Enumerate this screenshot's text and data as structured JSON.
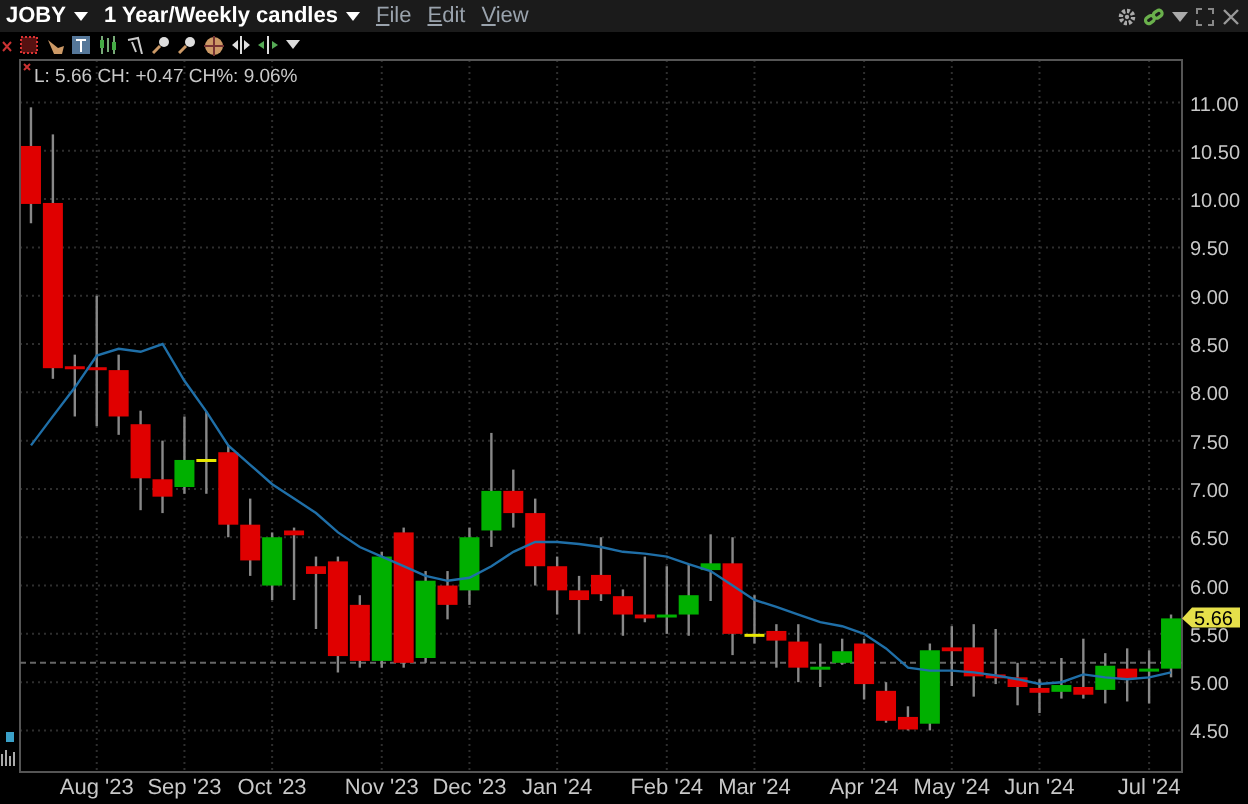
{
  "window": {
    "symbol": "JOBY",
    "period": "1 Year/Weekly candles",
    "menu": [
      "File",
      "Edit",
      "View"
    ]
  },
  "chart": {
    "info_line": "L: 5.66 CH: +0.47 CH%: 9.06%",
    "last_price": "5.66",
    "chart_data": {
      "type": "candlestick",
      "ylim": [
        4.07,
        11.44
      ],
      "categories": [
        null,
        null,
        null,
        "Aug '23",
        null,
        null,
        null,
        "Sep '23",
        null,
        null,
        null,
        "Oct '23",
        null,
        null,
        null,
        null,
        "Nov '23",
        null,
        null,
        null,
        "Dec '23",
        null,
        null,
        null,
        "Jan '24",
        null,
        null,
        null,
        null,
        "Feb '24",
        null,
        null,
        null,
        "Mar '24",
        null,
        null,
        null,
        null,
        "Apr '24",
        null,
        null,
        null,
        "May '24",
        null,
        null,
        null,
        "Jun '24",
        null,
        null,
        null,
        null,
        "Jul '24",
        null
      ],
      "ohlc": [
        [
          10.55,
          10.95,
          9.75,
          9.95
        ],
        [
          9.96,
          10.67,
          8.14,
          8.25
        ],
        [
          8.27,
          8.39,
          7.75,
          8.24
        ],
        [
          8.26,
          9.0,
          7.65,
          8.23
        ],
        [
          8.23,
          8.39,
          7.56,
          7.75
        ],
        [
          7.67,
          7.81,
          6.78,
          7.11
        ],
        [
          7.1,
          7.5,
          6.75,
          6.92
        ],
        [
          7.02,
          7.75,
          6.95,
          7.3
        ],
        [
          7.31,
          7.8,
          6.95,
          7.31
        ],
        [
          7.38,
          7.45,
          6.5,
          6.63
        ],
        [
          6.63,
          6.9,
          6.1,
          6.26
        ],
        [
          6.0,
          6.55,
          5.85,
          6.5
        ],
        [
          6.57,
          6.6,
          5.85,
          6.52
        ],
        [
          6.2,
          6.3,
          5.55,
          6.12
        ],
        [
          6.25,
          6.3,
          5.1,
          5.27
        ],
        [
          5.8,
          5.9,
          5.15,
          5.22
        ],
        [
          5.22,
          6.35,
          5.15,
          6.3
        ],
        [
          6.55,
          6.6,
          5.15,
          5.2
        ],
        [
          5.25,
          6.15,
          5.2,
          6.05
        ],
        [
          6.0,
          6.15,
          5.65,
          5.8
        ],
        [
          5.95,
          6.6,
          5.8,
          6.5
        ],
        [
          6.57,
          7.58,
          6.4,
          6.98
        ],
        [
          6.98,
          7.2,
          6.6,
          6.75
        ],
        [
          6.75,
          6.9,
          6.0,
          6.2
        ],
        [
          6.2,
          6.3,
          5.7,
          5.95
        ],
        [
          5.95,
          6.1,
          5.5,
          5.85
        ],
        [
          6.11,
          6.5,
          5.84,
          5.91
        ],
        [
          5.89,
          5.96,
          5.48,
          5.7
        ],
        [
          5.7,
          6.3,
          5.62,
          5.66
        ],
        [
          5.68,
          6.2,
          5.5,
          5.7
        ],
        [
          5.7,
          6.22,
          5.48,
          5.9
        ],
        [
          6.16,
          6.53,
          5.84,
          6.23
        ],
        [
          6.23,
          6.5,
          5.28,
          5.5
        ],
        [
          5.5,
          5.9,
          5.4,
          5.5
        ],
        [
          5.53,
          5.6,
          5.15,
          5.43
        ],
        [
          5.42,
          5.6,
          5.0,
          5.15
        ],
        [
          5.14,
          5.4,
          4.95,
          5.16
        ],
        [
          5.2,
          5.45,
          5.18,
          5.32
        ],
        [
          5.4,
          5.45,
          4.82,
          4.98
        ],
        [
          4.91,
          5.0,
          4.58,
          4.6
        ],
        [
          4.64,
          4.75,
          4.5,
          4.51
        ],
        [
          4.57,
          5.4,
          4.5,
          5.33
        ],
        [
          5.36,
          5.58,
          4.96,
          5.32
        ],
        [
          5.36,
          5.6,
          4.85,
          5.06
        ],
        [
          5.08,
          5.55,
          4.98,
          5.04
        ],
        [
          5.05,
          5.2,
          4.76,
          4.95
        ],
        [
          4.94,
          5.03,
          4.68,
          4.89
        ],
        [
          4.9,
          5.25,
          4.83,
          4.97
        ],
        [
          4.95,
          5.45,
          4.83,
          4.87
        ],
        [
          4.92,
          5.3,
          4.78,
          5.17
        ],
        [
          5.14,
          5.35,
          4.8,
          5.04
        ],
        [
          5.12,
          5.33,
          4.78,
          5.14
        ],
        [
          5.14,
          5.7,
          5.05,
          5.66
        ]
      ],
      "series": [
        {
          "type": "line",
          "color": "#1f6fa8",
          "values": [
            7.45,
            7.75,
            8.05,
            8.38,
            8.45,
            8.42,
            8.5,
            8.12,
            7.8,
            7.45,
            7.25,
            7.05,
            6.9,
            6.75,
            6.55,
            6.4,
            6.3,
            6.2,
            6.1,
            6.05,
            6.08,
            6.2,
            6.35,
            6.45,
            6.45,
            6.43,
            6.4,
            6.35,
            6.33,
            6.3,
            6.22,
            6.15,
            6.0,
            5.85,
            5.78,
            5.7,
            5.62,
            5.58,
            5.5,
            5.35,
            5.15,
            5.12,
            5.12,
            5.1,
            5.07,
            5.03,
            4.98,
            5.0,
            5.08,
            5.05,
            5.03,
            5.05,
            5.1
          ]
        }
      ],
      "yticks": [
        {
          "value": 4.5,
          "label": "4.50"
        },
        {
          "value": 5,
          "label": "5.00"
        },
        {
          "value": 5.5,
          "label": "5.50"
        },
        {
          "value": 6,
          "label": "6.00"
        },
        {
          "value": 6.5,
          "label": "6.50"
        },
        {
          "value": 7,
          "label": "7.00"
        },
        {
          "value": 7.5,
          "label": "7.50"
        },
        {
          "value": 8,
          "label": "8.00"
        },
        {
          "value": 8.5,
          "label": "8.50"
        },
        {
          "value": 9,
          "label": "9.00"
        },
        {
          "value": 9.5,
          "label": "9.50"
        },
        {
          "value": 10,
          "label": "10.00"
        },
        {
          "value": 10.5,
          "label": "10.50"
        },
        {
          "value": 11,
          "label": "11.00"
        }
      ],
      "grid": true,
      "ref_lines": [
        {
          "axis": "y",
          "value": 5.2
        }
      ]
    }
  }
}
